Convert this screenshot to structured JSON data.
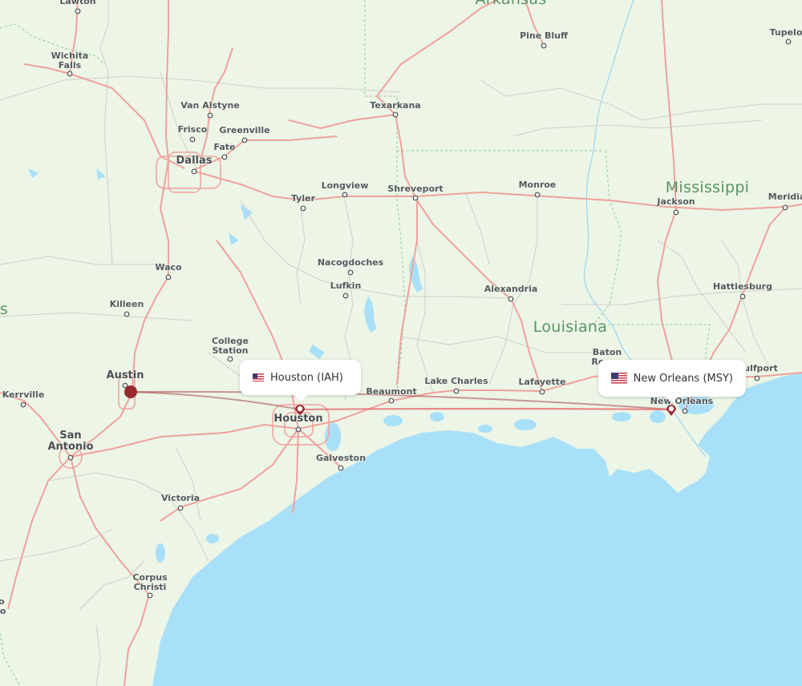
{
  "map": {
    "colors": {
      "land": "#ecf5e6",
      "water": "#a9e0f9",
      "highway": "#f0a19c",
      "road": "#c8c8c4",
      "route_dark": "#a8474c",
      "route_light": "#e8636a",
      "marker": "#9b2a2e",
      "state_label": "#5a9463"
    },
    "states": [
      {
        "name": "Arkansas"
      },
      {
        "name": "Mississippi"
      },
      {
        "name": "Louisiana"
      },
      {
        "name": "s"
      }
    ],
    "cities": [
      {
        "name": "Lawton"
      },
      {
        "name": "Wichita Falls"
      },
      {
        "name": "Van Alstyne"
      },
      {
        "name": "Frisco"
      },
      {
        "name": "Greenville"
      },
      {
        "name": "Fate"
      },
      {
        "name": "Dallas"
      },
      {
        "name": "Texarkana"
      },
      {
        "name": "Pine Bluff"
      },
      {
        "name": "Tupelo"
      },
      {
        "name": "Longview"
      },
      {
        "name": "Tyler"
      },
      {
        "name": "Shreveport"
      },
      {
        "name": "Monroe"
      },
      {
        "name": "Jackson"
      },
      {
        "name": "Meridian"
      },
      {
        "name": "Waco"
      },
      {
        "name": "Nacogdoches"
      },
      {
        "name": "Lufkin"
      },
      {
        "name": "Alexandria"
      },
      {
        "name": "Hattiesburg"
      },
      {
        "name": "Killeen"
      },
      {
        "name": "College Station"
      },
      {
        "name": "Baton Rouge"
      },
      {
        "name": "Austin"
      },
      {
        "name": "Kerrville"
      },
      {
        "name": "Beaumont"
      },
      {
        "name": "Lake Charles"
      },
      {
        "name": "Lafayette"
      },
      {
        "name": "Gulfport"
      },
      {
        "name": "Houston"
      },
      {
        "name": "New Orleans"
      },
      {
        "name": "San Antonio"
      },
      {
        "name": "Galveston"
      },
      {
        "name": "Victoria"
      },
      {
        "name": "Corpus Christi"
      },
      {
        "name": "Nuevo Laredo"
      }
    ],
    "airports": [
      {
        "name": "Austin",
        "role": "origin"
      },
      {
        "name": "Houston (IAH)",
        "country": "US",
        "flag": "us-flag-icon"
      },
      {
        "name": "New Orleans (MSY)",
        "country": "US",
        "flag": "us-flag-icon"
      }
    ],
    "routes": [
      {
        "from": "Austin",
        "to": "Houston (IAH)"
      },
      {
        "from": "Austin",
        "to": "New Orleans (MSY)"
      },
      {
        "from": "Houston (IAH)",
        "to": "New Orleans (MSY)"
      }
    ],
    "popups": {
      "houston": "Houston (IAH)",
      "new_orleans": "New Orleans (MSY)"
    }
  }
}
